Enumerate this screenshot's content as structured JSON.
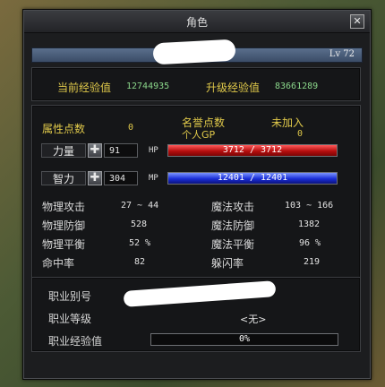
{
  "window": {
    "title": "角色",
    "close_glyph": "✕"
  },
  "character": {
    "level": "Lv 72"
  },
  "experience": {
    "current_label": "当前经验值",
    "current_value": "12744935",
    "next_label": "升级经验值",
    "next_value": "83661289"
  },
  "points": {
    "attr_label": "属性点数",
    "attr_value": "0",
    "fame_label": "名誉点数",
    "fame_status": "未加入",
    "gp_label": "个人GP",
    "gp_value": "0"
  },
  "stats": [
    {
      "label": "力量",
      "value": "91",
      "bar_tag": "HP",
      "bar_text": "3712 / 3712",
      "fill": 1.0
    },
    {
      "label": "智力",
      "value": "304",
      "bar_tag": "MP",
      "bar_text": "12401 / 12401",
      "fill": 1.0
    }
  ],
  "attributes": {
    "left": [
      {
        "label": "物理攻击",
        "value": "27 ~ 44"
      },
      {
        "label": "物理防御",
        "value": "528"
      },
      {
        "label": "物理平衡",
        "value": "52 %"
      },
      {
        "label": "命中率",
        "value": "82"
      }
    ],
    "right": [
      {
        "label": "魔法攻击",
        "value": "103 ~ 166"
      },
      {
        "label": "魔法防御",
        "value": "1382"
      },
      {
        "label": "魔法平衡",
        "value": "96 %"
      },
      {
        "label": "躲闪率",
        "value": "219"
      }
    ]
  },
  "job": {
    "alias_label": "职业别号",
    "level_label": "职业等级",
    "level_value": "<无>",
    "exp_label": "职业经验值",
    "exp_value": "0%",
    "exp_fill": 0.0
  },
  "colors": {
    "hp": "#c41414",
    "mp": "#1a2ed8",
    "label_yellow": "#e0c94a",
    "value_green": "#8ad68a"
  }
}
